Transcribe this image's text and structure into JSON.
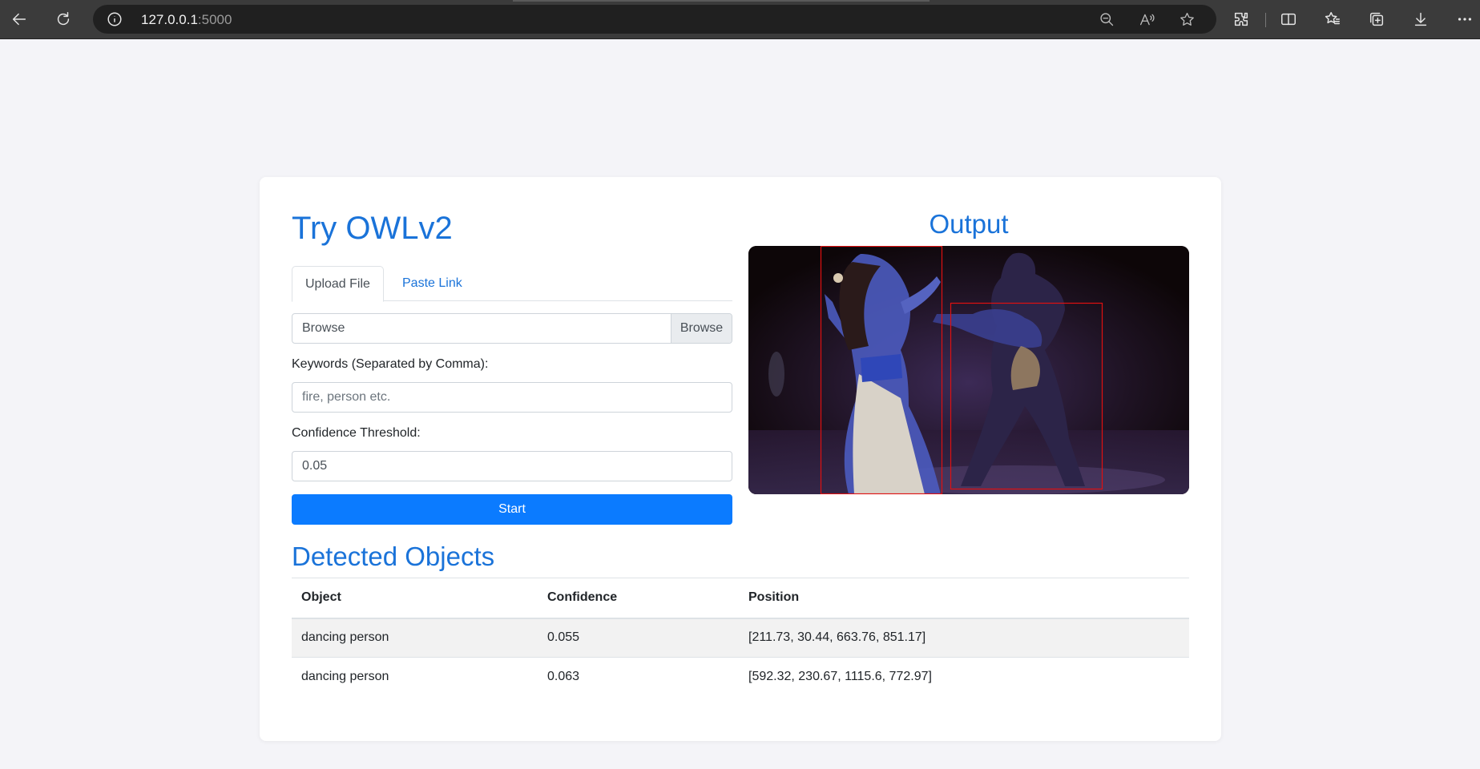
{
  "browser": {
    "url_host": "127.0.0.1",
    "url_port": ":5000",
    "icons": [
      "back-icon",
      "reload-icon",
      "info-icon",
      "zoom-out-icon",
      "read-aloud-icon",
      "favorite-star-icon",
      "extensions-icon",
      "split-screen-icon",
      "favorites-icon",
      "collections-icon",
      "downloads-icon",
      "more-icon"
    ]
  },
  "page": {
    "title": "Try OWLv2",
    "tabs": [
      {
        "label": "Upload File",
        "active": true
      },
      {
        "label": "Paste Link",
        "active": false
      }
    ],
    "file_input": {
      "text": "Browse",
      "button": "Browse"
    },
    "keywords": {
      "label": "Keywords (Separated by Comma):",
      "placeholder": "fire, person etc.",
      "value": ""
    },
    "threshold": {
      "label": "Confidence Threshold:",
      "value": "0.05"
    },
    "start_label": "Start",
    "output_title": "Output",
    "detected_title": "Detected Objects",
    "table": {
      "headers": [
        "Object",
        "Confidence",
        "Position"
      ],
      "rows": [
        [
          "dancing person",
          "0.055",
          "[211.73, 30.44, 663.76, 851.17]"
        ],
        [
          "dancing person",
          "0.063",
          "[592.32, 230.67, 1115.6, 772.97]"
        ]
      ]
    }
  },
  "colors": {
    "accent": "#1a73d9",
    "button": "#0b7bff",
    "box": "#e01010"
  }
}
